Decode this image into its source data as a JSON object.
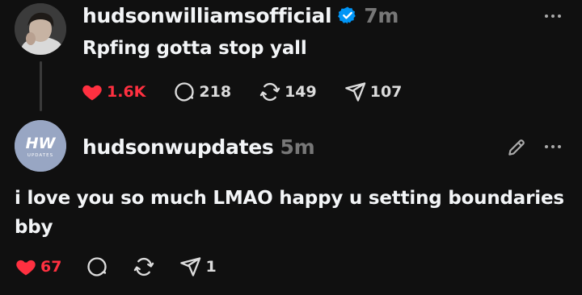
{
  "colors": {
    "background": "#101010",
    "text": "#f3f5f7",
    "muted": "#777777",
    "like": "#ff3040",
    "verified": "#0095f6"
  },
  "posts": [
    {
      "username": "hudsonwilliamsofficial",
      "verified": true,
      "time": "7m",
      "text": "Rpfing gotta stop yall",
      "likes": "1.6K",
      "comments": "218",
      "reposts": "149",
      "shares": "107",
      "icons": [
        "heart-filled-icon",
        "comment-icon",
        "repost-icon",
        "share-icon",
        "more-icon"
      ]
    },
    {
      "username": "hudsonwupdates",
      "verified": false,
      "time": "5m",
      "text": "i love you so much LMAO happy u setting boundaries bby",
      "likes": "67",
      "comments": "",
      "reposts": "",
      "shares": "1",
      "avatar_logo": "HW",
      "avatar_sub": "UPDATES",
      "icons": [
        "heart-filled-icon",
        "comment-icon",
        "repost-icon",
        "share-icon",
        "edit-icon",
        "more-icon"
      ]
    }
  ]
}
